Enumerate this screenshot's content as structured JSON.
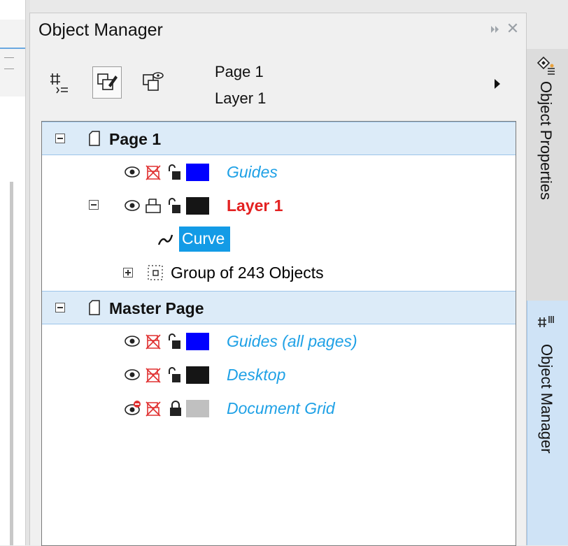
{
  "docker": {
    "title": "Object Manager",
    "pin_glyph": "⏵⏵",
    "close_glyph": "✕"
  },
  "toolbar": {
    "buttons": [
      {
        "name": "object-properties-toggle",
        "icon": "properties-list-icon",
        "active": false
      },
      {
        "name": "edit-across-layers",
        "icon": "edit-across-layers-icon",
        "active": true
      },
      {
        "name": "layer-manager-view",
        "icon": "layer-view-icon",
        "active": false
      }
    ],
    "current_page": "Page 1",
    "current_layer": "Layer 1",
    "more_icon": "triangle-right-icon"
  },
  "tree": {
    "page1": {
      "label": "Page 1",
      "expanded": true,
      "guides": {
        "label": "Guides",
        "color": "#0000ff"
      },
      "layer1": {
        "label": "Layer 1",
        "color": "#151515",
        "label_color": "#e32121"
      },
      "curve": {
        "label": "Curve",
        "selected": true
      },
      "group": {
        "label": "Group of 243 Objects",
        "expanded": false
      }
    },
    "master": {
      "label": "Master Page",
      "expanded": true,
      "guides_all": {
        "label": "Guides (all pages)",
        "color": "#0000ff"
      },
      "desktop": {
        "label": "Desktop",
        "color": "#151515"
      },
      "grid": {
        "label": "Document Grid",
        "color": "#c0c0c0"
      }
    }
  },
  "side_tabs": {
    "properties": "Object Properties",
    "manager": "Object Manager"
  },
  "colors": {
    "accent": "#139be6",
    "page_row_bg": "#dcebf8",
    "master_label": "#1fa1e6",
    "icon_red": "#e03030"
  }
}
